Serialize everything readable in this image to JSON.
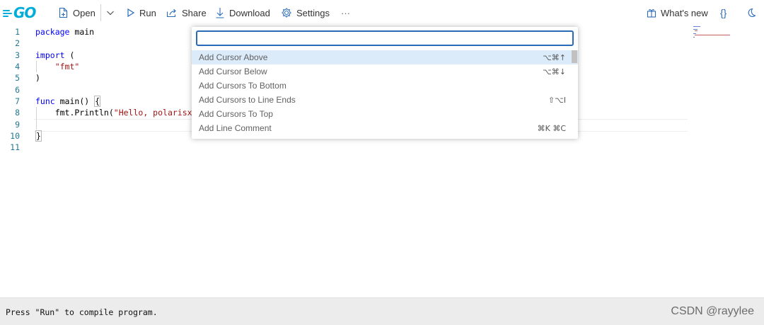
{
  "header": {
    "logo_text": "GO",
    "open_label": "Open",
    "run_label": "Run",
    "share_label": "Share",
    "download_label": "Download",
    "settings_label": "Settings",
    "more_label": "···",
    "whats_new_label": "What's new",
    "format_label": "{}",
    "icons": [
      "file-plus-icon",
      "chevron-down-icon",
      "play-icon",
      "share-icon",
      "download-icon",
      "gear-icon",
      "gift-icon",
      "moon-icon"
    ]
  },
  "editor": {
    "line_numbers": [
      "1",
      "2",
      "3",
      "4",
      "5",
      "6",
      "7",
      "8",
      "9",
      "10",
      "11"
    ],
    "lines": {
      "l1_kw": "package",
      "l1_rest": " main",
      "l3_kw": "import",
      "l3_rest": " (",
      "l4_str": "\"fmt\"",
      "l5": ")",
      "l7_kw": "func",
      "l7_rest": " main() ",
      "l7_brace": "{",
      "l8_pre": "    fmt.Println(",
      "l8_str": "\"Hello, polarisxu,",
      "l10_brace": "}"
    }
  },
  "palette": {
    "input_value": "",
    "items": [
      {
        "label": "Add Cursor Above",
        "keybinding": "⌥⌘↑",
        "selected": true
      },
      {
        "label": "Add Cursor Below",
        "keybinding": "⌥⌘↓",
        "selected": false
      },
      {
        "label": "Add Cursors To Bottom",
        "keybinding": "",
        "selected": false
      },
      {
        "label": "Add Cursors to Line Ends",
        "keybinding": "⇧⌥I",
        "selected": false
      },
      {
        "label": "Add Cursors To Top",
        "keybinding": "",
        "selected": false
      },
      {
        "label": "Add Line Comment",
        "keybinding": "⌘K ⌘C",
        "selected": false
      }
    ]
  },
  "footer": {
    "output_text": "Press \"Run\" to compile program.",
    "watermark": "CSDN @rayylee"
  },
  "colors": {
    "brand": "#00ADD8",
    "line_number": "#237893",
    "keyword": "#0000ff",
    "string": "#a31515",
    "selection": "#dcebfa",
    "input_border": "#2a6bb8"
  }
}
